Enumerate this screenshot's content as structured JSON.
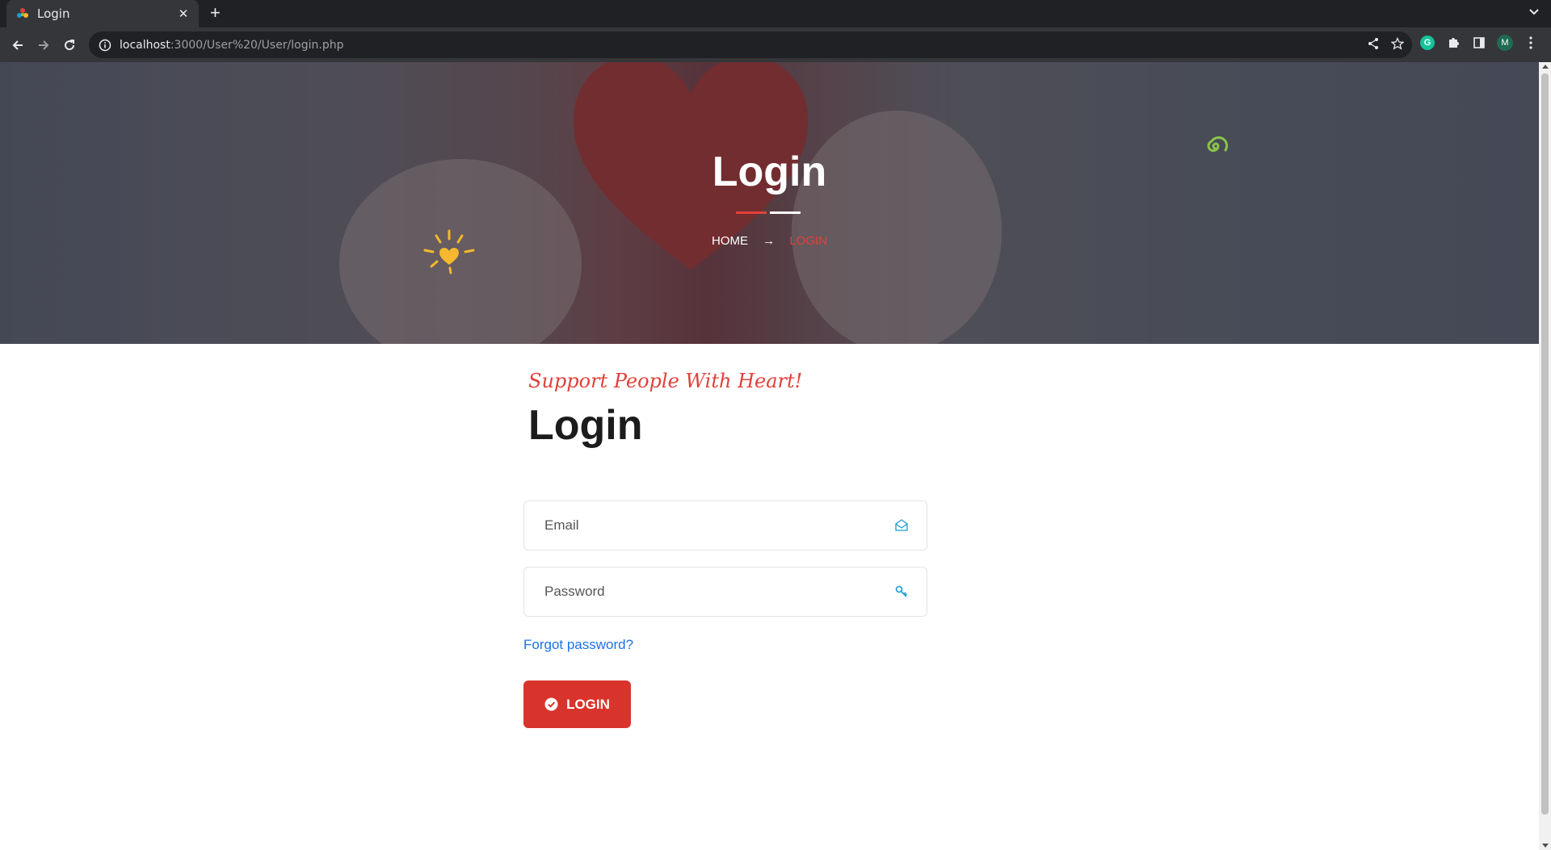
{
  "browser": {
    "tab_title": "Login",
    "tab_close": "✕",
    "new_tab": "+",
    "url_host": "localhost",
    "url_rest": ":3000/User%20/User/login.php",
    "profile_initial": "M",
    "grammarly_letter": "G"
  },
  "hero": {
    "title": "Login",
    "breadcrumb": {
      "home": "HOME",
      "separator": "→",
      "current": "LOGIN"
    }
  },
  "login": {
    "tagline": "Support People With Heart!",
    "title": "Login",
    "email_placeholder": "Email",
    "password_placeholder": "Password",
    "forgot_password": "Forgot password?",
    "submit_label": "LOGIN"
  },
  "colors": {
    "accent_red": "#e0413a",
    "button_red": "#d9342c",
    "link_blue": "#1a73e8",
    "icon_cyan": "#1b9bd1",
    "sun_yellow": "#f5b82e",
    "swirl_green": "#8bc34a"
  }
}
